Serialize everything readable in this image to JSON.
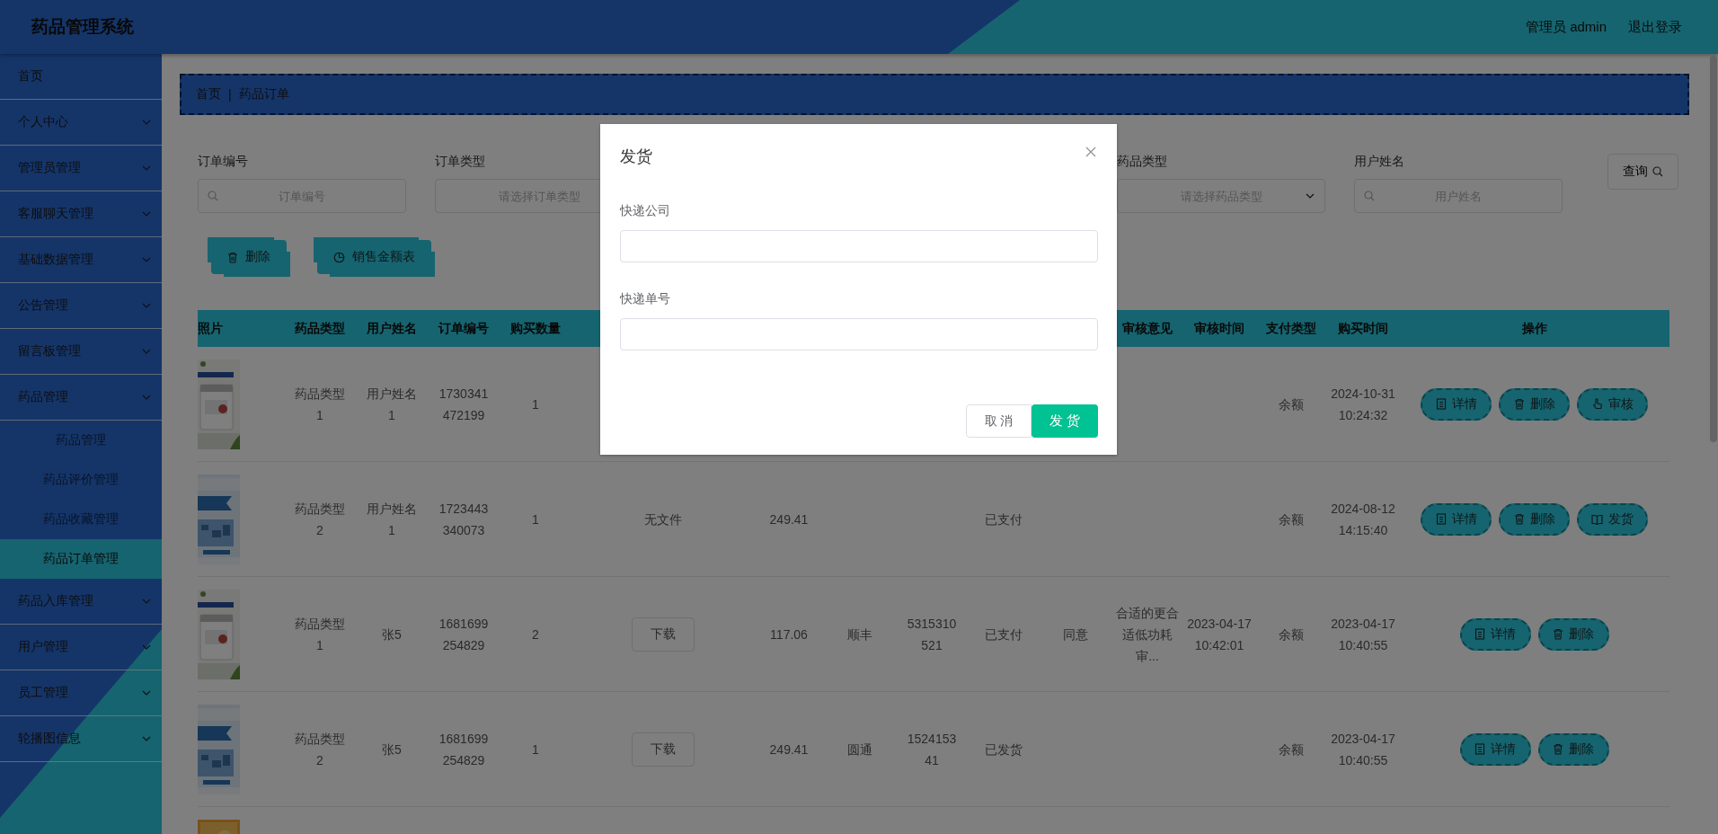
{
  "header": {
    "title": "药品管理系统",
    "user": "管理员 admin",
    "logout": "退出登录"
  },
  "sidebar": {
    "items": [
      {
        "label": "首页",
        "kind": "link"
      },
      {
        "label": "个人中心",
        "kind": "submenu"
      },
      {
        "label": "管理员管理",
        "kind": "submenu"
      },
      {
        "label": "客服聊天管理",
        "kind": "submenu"
      },
      {
        "label": "基础数据管理",
        "kind": "submenu"
      },
      {
        "label": "公告管理",
        "kind": "submenu"
      },
      {
        "label": "留言板管理",
        "kind": "submenu"
      },
      {
        "label": "药品管理",
        "kind": "submenu",
        "children": [
          {
            "label": "药品管理",
            "selected": false
          },
          {
            "label": "药品评价管理",
            "selected": false
          },
          {
            "label": "药品收藏管理",
            "selected": false
          },
          {
            "label": "药品订单管理",
            "selected": true
          }
        ]
      },
      {
        "label": "药品入库管理",
        "kind": "submenu"
      },
      {
        "label": "用户管理",
        "kind": "submenu"
      },
      {
        "label": "员工管理",
        "kind": "submenu"
      },
      {
        "label": "轮播图信息",
        "kind": "submenu"
      }
    ]
  },
  "breadcrumb": {
    "items": [
      "首页",
      "药品订单"
    ],
    "separator": "|"
  },
  "filters": [
    {
      "label": "订单编号",
      "kind": "search",
      "placeholder": "订单编号"
    },
    {
      "label": "订单类型",
      "kind": "select",
      "placeholder": "请选择订单类型"
    },
    {
      "label": "药品类型",
      "kind": "select",
      "placeholder": "请选择药品类型"
    },
    {
      "label": "用户姓名",
      "kind": "search",
      "placeholder": "用户姓名"
    }
  ],
  "query_button": "查询",
  "toolbar": [
    {
      "kind": "delete",
      "label": "删除"
    },
    {
      "kind": "chart",
      "label": "销售金额表"
    }
  ],
  "table": {
    "columns_left": [
      "照片",
      "药品类型",
      "用户姓名",
      "订单编号",
      "购买数量"
    ],
    "columns_right": [
      "审核意见",
      "审核时间",
      "支付类型",
      "购买时间",
      "操作"
    ],
    "rows": [
      {
        "photo": {
          "kind": "picture"
        },
        "drug_type": "药品类型1",
        "user_name": "用户姓名1",
        "order_no": "1730341472199",
        "quantity": "1",
        "payment_type": "余额",
        "purchase_time": "2024-10-31 10:24:32",
        "actions": [
          {
            "kind": "detail",
            "label": "详情"
          },
          {
            "kind": "delete",
            "label": "删除"
          },
          {
            "kind": "review",
            "label": "审核"
          }
        ]
      },
      {
        "photo": {
          "kind": "picture"
        },
        "drug_type": "药品类型2",
        "user_name": "用户姓名1",
        "order_no": "1723443340073",
        "quantity": "1",
        "column_6": {
          "kind": "text",
          "label": "无文件"
        },
        "column_7": "249.41",
        "column_10": "已支付",
        "payment_type": "余额",
        "purchase_time": "2024-08-12 14:15:40",
        "actions": [
          {
            "kind": "detail",
            "label": "详情"
          },
          {
            "kind": "delete",
            "label": "删除"
          },
          {
            "kind": "ship",
            "label": "发货"
          }
        ]
      },
      {
        "photo": {
          "kind": "picture"
        },
        "drug_type": "药品类型1",
        "user_name": "张5",
        "order_no": "1681699254829",
        "quantity": "2",
        "column_6": {
          "kind": "button",
          "label": "下载"
        },
        "column_7": "117.06",
        "column_8": "顺丰",
        "column_9": "5315310521",
        "column_10": "已支付",
        "column_11": "同意",
        "review_opinion": "合适的更合适低功耗审...",
        "review_time": "2023-04-17 10:42:01",
        "payment_type": "余额",
        "purchase_time": "2023-04-17 10:40:55",
        "actions": [
          {
            "kind": "detail",
            "label": "详情"
          },
          {
            "kind": "delete",
            "label": "删除"
          }
        ]
      },
      {
        "photo": {
          "kind": "picture"
        },
        "drug_type": "药品类型2",
        "user_name": "张5",
        "order_no": "1681699254829",
        "quantity": "1",
        "column_6": {
          "kind": "button",
          "label": "下载"
        },
        "column_7": "249.41",
        "column_8": "圆通",
        "column_9": "152415341",
        "column_10": "已发货",
        "payment_type": "余额",
        "purchase_time": "2023-04-17 10:40:55",
        "actions": [
          {
            "kind": "detail",
            "label": "详情"
          },
          {
            "kind": "delete",
            "label": "删除"
          }
        ]
      },
      {
        "photo": {
          "kind": "picture"
        }
      }
    ]
  },
  "dialog": {
    "title": "发货",
    "fields": [
      {
        "label": "快递公司"
      },
      {
        "label": "快递单号"
      }
    ],
    "cancel": "取 消",
    "confirm": "发 货"
  }
}
